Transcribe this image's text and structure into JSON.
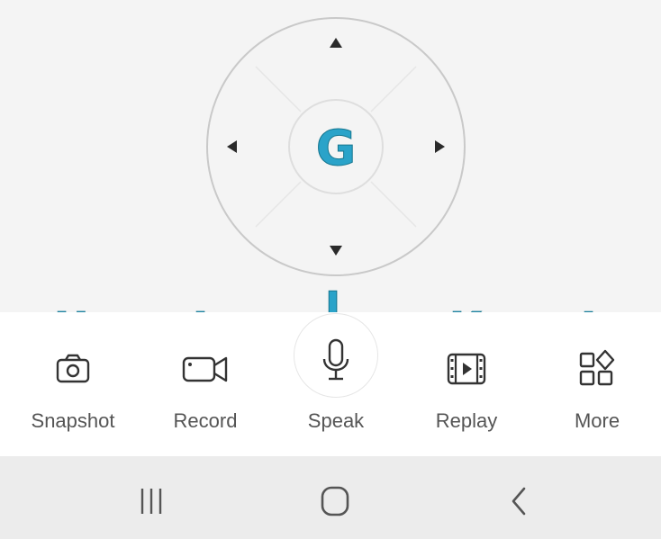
{
  "colors": {
    "panel_bg": "#f4f4f4",
    "nav_bg": "#ececec",
    "annotation": "#2aa3c9",
    "icon": "#333333",
    "label": "#555555"
  },
  "ptz": {
    "center_letter": "G",
    "arrows": [
      "up",
      "down",
      "left",
      "right"
    ]
  },
  "annotations": [
    "H",
    "I",
    "J",
    "K",
    "L"
  ],
  "actions": [
    {
      "label": "Snapshot",
      "icon": "camera-icon"
    },
    {
      "label": "Record",
      "icon": "video-camera-icon"
    },
    {
      "label": "Speak",
      "icon": "microphone-icon"
    },
    {
      "label": "Replay",
      "icon": "film-play-icon"
    },
    {
      "label": "More",
      "icon": "apps-grid-icon"
    }
  ],
  "nav": {
    "buttons": [
      "recent-apps-icon",
      "home-icon",
      "back-icon"
    ]
  }
}
